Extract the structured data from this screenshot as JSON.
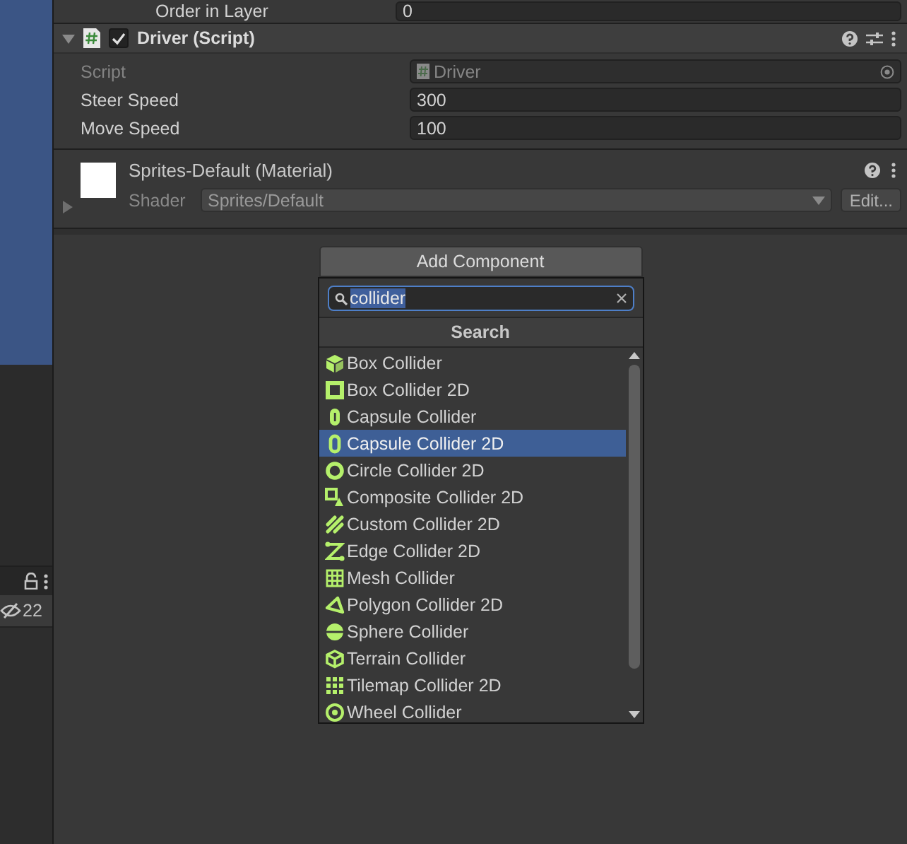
{
  "left_panel": {
    "hidden_count": "22"
  },
  "order_in_layer": {
    "label": "Order in Layer",
    "value": "0"
  },
  "script_component": {
    "title": "Driver (Script)",
    "enabled": true,
    "expanded": true,
    "properties": [
      {
        "kind": "object",
        "label": "Script",
        "value": "Driver",
        "disabled": true
      },
      {
        "kind": "number",
        "label": "Steer Speed",
        "value": "300",
        "disabled": false
      },
      {
        "kind": "number",
        "label": "Move Speed",
        "value": "100",
        "disabled": false
      }
    ]
  },
  "material": {
    "title": "Sprites-Default (Material)",
    "expanded": false,
    "shader_label": "Shader",
    "shader": "Sprites/Default",
    "edit_button": "Edit..."
  },
  "add_component": {
    "button": "Add Component",
    "search": {
      "value": "collider"
    },
    "header": "Search",
    "items": [
      {
        "label": "Box Collider",
        "kind": "box",
        "selected": false
      },
      {
        "label": "Box Collider 2D",
        "kind": "box2d",
        "selected": false
      },
      {
        "label": "Capsule Collider",
        "kind": "capsule",
        "selected": false
      },
      {
        "label": "Capsule Collider 2D",
        "kind": "capsule2d",
        "selected": true
      },
      {
        "label": "Circle Collider 2D",
        "kind": "circle2d",
        "selected": false
      },
      {
        "label": "Composite Collider 2D",
        "kind": "composite",
        "selected": false
      },
      {
        "label": "Custom Collider 2D",
        "kind": "custom",
        "selected": false
      },
      {
        "label": "Edge Collider 2D",
        "kind": "edge",
        "selected": false
      },
      {
        "label": "Mesh Collider",
        "kind": "mesh",
        "selected": false
      },
      {
        "label": "Polygon Collider 2D",
        "kind": "polygon",
        "selected": false
      },
      {
        "label": "Sphere Collider",
        "kind": "sphere",
        "selected": false
      },
      {
        "label": "Terrain Collider",
        "kind": "terrain",
        "selected": false
      },
      {
        "label": "Tilemap Collider 2D",
        "kind": "tilemap",
        "selected": false
      },
      {
        "label": "Wheel Collider",
        "kind": "wheel",
        "selected": false
      }
    ]
  }
}
